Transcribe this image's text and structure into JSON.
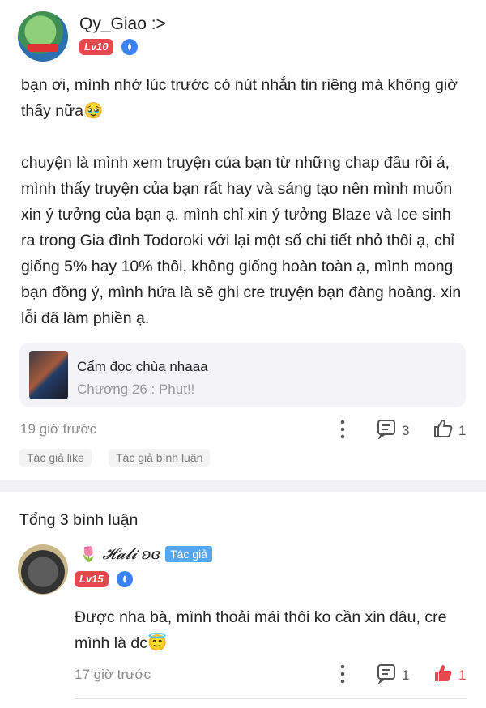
{
  "post": {
    "username": "Qy_Giao :>",
    "level": "Lv10",
    "paragraph1": "bạn ơi, mình nhớ lúc trước có nút nhắn tin riêng mà không giờ thấy nữa🥹",
    "paragraph2": "chuyện là mình xem truyện của bạn từ những chap đầu rồi á, mình thấy truyện của bạn rất hay và sáng tạo nên mình muốn xin ý tưởng của bạn ạ. mình chỉ xin ý tưởng Blaze và Ice sinh ra trong Gia đình Todoroki với lại một số chi tiết nhỏ thôi ạ, chỉ giống 5% hay 10% thôi, không giống hoàn toàn ạ, mình mong bạn đồng ý, mình hứa là sẽ ghi cre truyện bạn đàng hoàng. xin lỗi đã làm phiền ạ.",
    "story_card": {
      "title": "Cấm đọc chùa nhaaa",
      "chapter": "Chương 26 : Phụt!!"
    },
    "time": "19 giờ trước",
    "comment_count": "3",
    "like_count": "1",
    "chips": [
      "Tác giả like",
      "Tác giả bình luận"
    ]
  },
  "comments_header": "Tổng 3 bình luận",
  "reply": {
    "name_emoji": "🌷",
    "name": "𝓗𝓪𝓵𝓲 ʚɞ",
    "author_tag": "Tác giả",
    "level": "Lv15",
    "text": "Được nha bà, mình thoải mái thôi ko cần xin đâu, cre mình là đc😇",
    "time": "17 giờ trước",
    "comment_count": "1",
    "like_count": "1"
  },
  "colors": {
    "level_badge": "#e5484d",
    "author_tag": "#57a6ee",
    "liked": "#e5484d",
    "verified": "#3b82f6"
  }
}
